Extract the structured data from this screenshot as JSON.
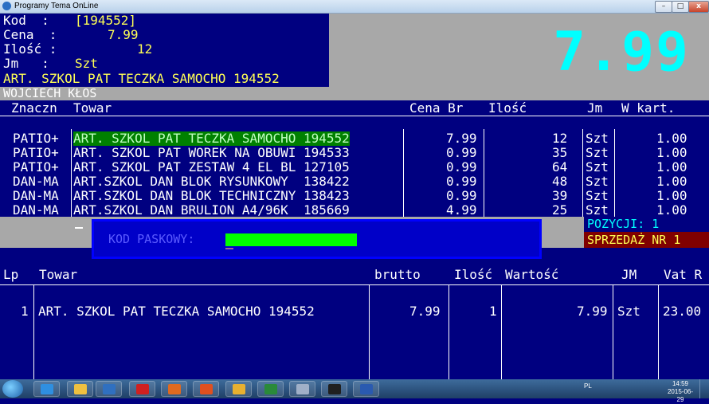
{
  "window": {
    "title": "Programy Tema OnLine",
    "min_glyph": "–",
    "max_glyph": "□",
    "close_glyph": "x"
  },
  "info": {
    "kod_label": "Kod  :",
    "kod_value": "[194552]",
    "cena_label": "Cena  :",
    "cena_value": "7.99",
    "ilosc_label": "Ilość :",
    "ilosc_value": "12",
    "jm_label": "Jm   :",
    "jm_value": "Szt",
    "product_name": "ART. SZKOL PAT TECZKA SAMOCHO 194552",
    "user": "WOJCIECH KŁOS"
  },
  "big_price": "7.99",
  "product_table": {
    "headers": {
      "znaczn": "Znaczn",
      "towar": "Towar",
      "cena_br": "Cena Br",
      "ilosc": "Ilość",
      "jm": "Jm",
      "w_kart": "W kart."
    },
    "rows": [
      {
        "znaczn": "PATIO+",
        "towar": "ART. SZKOL PAT TECZKA SAMOCHO 194552",
        "cena": "7.99",
        "ilosc": "12",
        "jm": "Szt",
        "w_kart": "1.00"
      },
      {
        "znaczn": "PATIO+",
        "towar": "ART. SZKOL PAT WOREK NA OBUWI 194533",
        "cena": "0.99",
        "ilosc": "35",
        "jm": "Szt",
        "w_kart": "1.00"
      },
      {
        "znaczn": "PATIO+",
        "towar": "ART. SZKOL PAT ZESTAW 4 EL BL 127105",
        "cena": "0.99",
        "ilosc": "64",
        "jm": "Szt",
        "w_kart": "1.00"
      },
      {
        "znaczn": "DAN-MA",
        "towar": "ART.SZKOL DAN BLOK RYSUNKOWY  138422",
        "cena": "0.99",
        "ilosc": "48",
        "jm": "Szt",
        "w_kart": "1.00"
      },
      {
        "znaczn": "DAN-MA",
        "towar": "ART.SZKOL DAN BLOK TECHNICZNY 138423",
        "cena": "0.99",
        "ilosc": "39",
        "jm": "Szt",
        "w_kart": "1.00"
      },
      {
        "znaczn": "DAN-MA",
        "towar": "ART.SZKOL DAN BRULION A4/96K  185669",
        "cena": "4.99",
        "ilosc": "25",
        "jm": "Szt",
        "w_kart": "1.00"
      }
    ]
  },
  "status": {
    "pozycji": "POZYCJI: 1",
    "sprzedaz": "SPRZEDAŻ NR 1"
  },
  "barcode_dialog": {
    "label": "KOD PASKOWY:"
  },
  "receipt_table": {
    "headers": {
      "lp": "Lp",
      "towar": "Towar",
      "brutto": "brutto",
      "ilosc": "Ilość",
      "wartosc": "Wartość",
      "jm": "JM",
      "vat": "Vat R"
    },
    "rows": [
      {
        "lp": "1",
        "towar": "ART. SZKOL PAT TECZKA SAMOCHO 194552",
        "brutto": "7.99",
        "ilosc": "1",
        "wartosc": "7.99",
        "jm": "Szt",
        "vat": "23.00"
      }
    ]
  },
  "taskbar": {
    "lang": "PL",
    "time": "14:59",
    "date": "2015-06-29",
    "items": [
      {
        "icon": "ie-icon",
        "color": "#2f8fe0"
      },
      {
        "icon": "explorer-icon",
        "color": "#f0c040"
      },
      {
        "icon": "media-icon",
        "color": "#3070c0"
      },
      {
        "icon": "app-red-icon",
        "color": "#d02020"
      },
      {
        "icon": "firefox-icon",
        "color": "#e06a20"
      },
      {
        "icon": "app-orange-icon",
        "color": "#e05020"
      },
      {
        "icon": "folder-icon",
        "color": "#e8b030"
      },
      {
        "icon": "excel-icon",
        "color": "#2a8a3a"
      },
      {
        "icon": "tool-icon",
        "color": "#a0b0c8"
      },
      {
        "icon": "terminal-icon",
        "color": "#202020"
      },
      {
        "icon": "word-icon",
        "color": "#2a5ab0"
      }
    ]
  }
}
